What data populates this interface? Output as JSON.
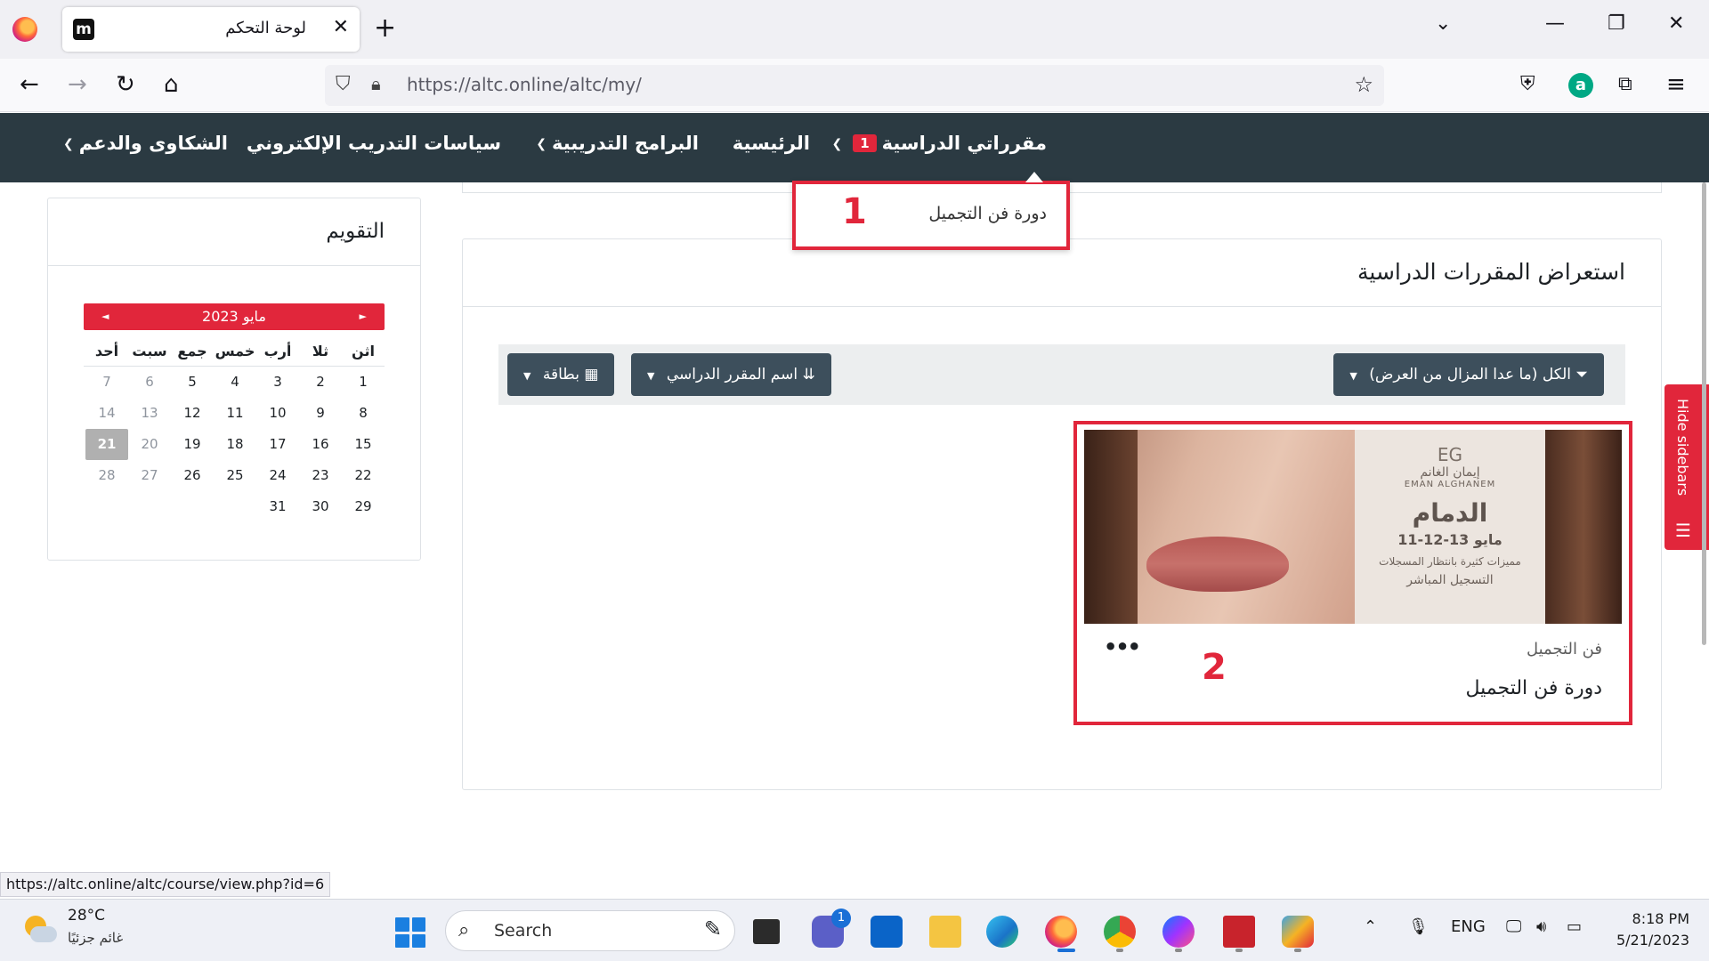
{
  "browser": {
    "tab_title": "لوحة التحكم",
    "tab_favicon_letter": "m",
    "url_domain": "https://altc.online",
    "url_path": "/altc/my/",
    "status_url": "https://altc.online/altc/course/view.php?id=6"
  },
  "site_nav": {
    "items": [
      {
        "label": "مقرراتي الدراسية",
        "badge": "1",
        "has_dropdown": true
      },
      {
        "label": "الرئيسية"
      },
      {
        "label": "البرامج التدريبية",
        "has_dropdown": true
      },
      {
        "label": "سياسات التدريب الإلكتروني"
      },
      {
        "label": "الشكاوى والدعم",
        "has_dropdown": true
      }
    ]
  },
  "dropdown": {
    "items": [
      "دورة فن التجميل"
    ]
  },
  "annotations": {
    "first": "1",
    "second": "2"
  },
  "course_overview": {
    "title": "استعراض المقررات الدراسية",
    "filter_label": "الكل (ما عدا المزال من العرض)",
    "sort_label": "اسم المقرر الدراسي",
    "view_label": "بطاقة",
    "course": {
      "category": "فن التجميل",
      "name": "دورة فن التجميل",
      "menu": "•••",
      "poster": {
        "logo": "EG",
        "brand_ar": "إيمان الغانم",
        "brand_en": "EMAN ALGHANEM",
        "city": "الدمام",
        "dates": "مايو 13-12-11",
        "note": "مميزات كثيرة بانتظار المسجلات",
        "sub": "التسجيل المباشر"
      }
    }
  },
  "calendar": {
    "title": "التقويم",
    "month": "مايو 2023",
    "prev": "◄",
    "next": "►",
    "weekdays": [
      "اثن",
      "ثلا",
      "أرب",
      "خمس",
      "جمع",
      "سبت",
      "أحد"
    ],
    "weeks": [
      [
        "1",
        "2",
        "3",
        "4",
        "5",
        "6",
        "7"
      ],
      [
        "8",
        "9",
        "10",
        "11",
        "12",
        "13",
        "14"
      ],
      [
        "15",
        "16",
        "17",
        "18",
        "19",
        "20",
        "21"
      ],
      [
        "22",
        "23",
        "24",
        "25",
        "26",
        "27",
        "28"
      ],
      [
        "29",
        "30",
        "31",
        "",
        "",
        "",
        ""
      ]
    ],
    "today": "21"
  },
  "hide_sidebars": "Hide sidebars",
  "taskbar": {
    "temp": "28°C",
    "condition": "غائم جزئيًا",
    "search": "Search",
    "teams_badge": "1",
    "language": "ENG",
    "time": "8:18 PM",
    "date": "5/21/2023"
  }
}
